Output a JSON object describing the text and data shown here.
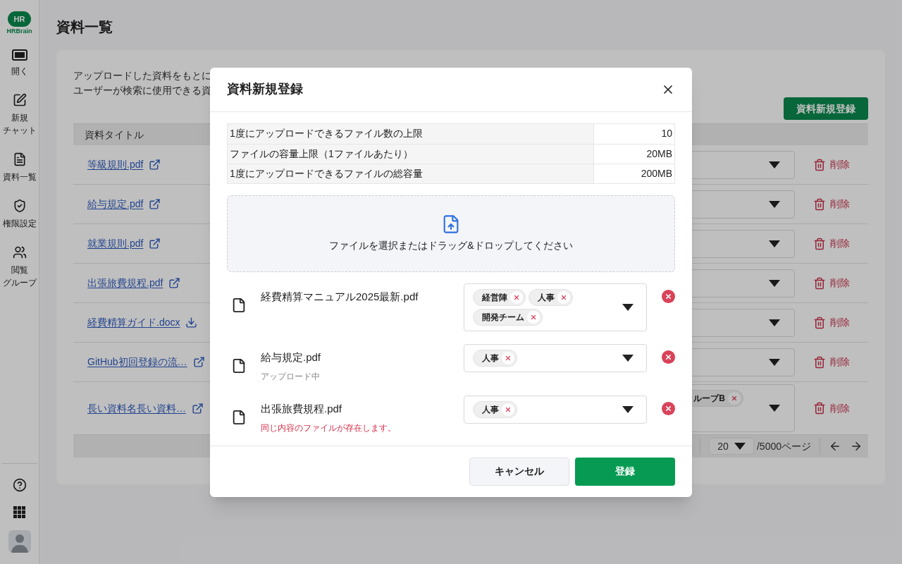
{
  "sidebar": {
    "logo": {
      "mark": "HR",
      "brand": "HRBrain"
    },
    "items": [
      {
        "lines": [
          "開く"
        ]
      },
      {
        "lines": [
          "新規",
          "チャット"
        ]
      },
      {
        "lines": [
          "資料一覧"
        ]
      },
      {
        "lines": [
          "権限設定"
        ]
      },
      {
        "lines": [
          "閲覧",
          "グループ"
        ]
      }
    ]
  },
  "page": {
    "title": "資料一覧",
    "description": [
      "アップロードした資料をもとに",
      "ユーザーが検索に使用できる資"
    ],
    "new_button": "資料新規登録",
    "table": {
      "columns": [
        "資料タイトル"
      ],
      "rows": [
        {
          "title": "等級規則.pdf",
          "kind": "external",
          "tags": [],
          "delete": "削除"
        },
        {
          "title": "給与規定.pdf",
          "kind": "external",
          "tags": [],
          "delete": "削除"
        },
        {
          "title": "就業規則.pdf",
          "kind": "external",
          "tags": [],
          "delete": "削除"
        },
        {
          "title": "出張旅費規程.pdf",
          "kind": "external",
          "tags": [],
          "delete": "削除"
        },
        {
          "title": "経費精算ガイド.docx",
          "kind": "download",
          "tags": [],
          "delete": "削除"
        },
        {
          "title": "GitHub初回登録の流…",
          "kind": "external",
          "tags": [],
          "delete": "削除"
        },
        {
          "title": "長い資料名長い資料…",
          "kind": "external",
          "tags": [
            "ループB"
          ],
          "delete": "削除"
        }
      ]
    },
    "pagination": {
      "per_page": "20",
      "pages": "/5000ページ"
    }
  },
  "modal": {
    "title": "資料新規登録",
    "limits": [
      {
        "label": "1度にアップロードできるファイル数の上限",
        "value": "10"
      },
      {
        "label": "ファイルの容量上限（1ファイルあたり）",
        "value": "20MB"
      },
      {
        "label": "1度にアップロードできるファイルの総容量",
        "value": "200MB"
      }
    ],
    "dropzone": "ファイルを選択またはドラッグ&ドロップしてください",
    "files": [
      {
        "name": "経費精算マニュアル2025最新.pdf",
        "tags": [
          "経営陣",
          "人事",
          "開発チーム"
        ]
      },
      {
        "name": "給与規定.pdf",
        "tags": [
          "人事"
        ],
        "status": {
          "kind": "progress",
          "text": "アップロード中"
        }
      },
      {
        "name": "出張旅費規程.pdf",
        "tags": [
          "人事"
        ],
        "status": {
          "kind": "error",
          "text": "同じ内容のファイルが存在します。"
        }
      }
    ],
    "cancel": "キャンセル",
    "submit": "登録"
  }
}
